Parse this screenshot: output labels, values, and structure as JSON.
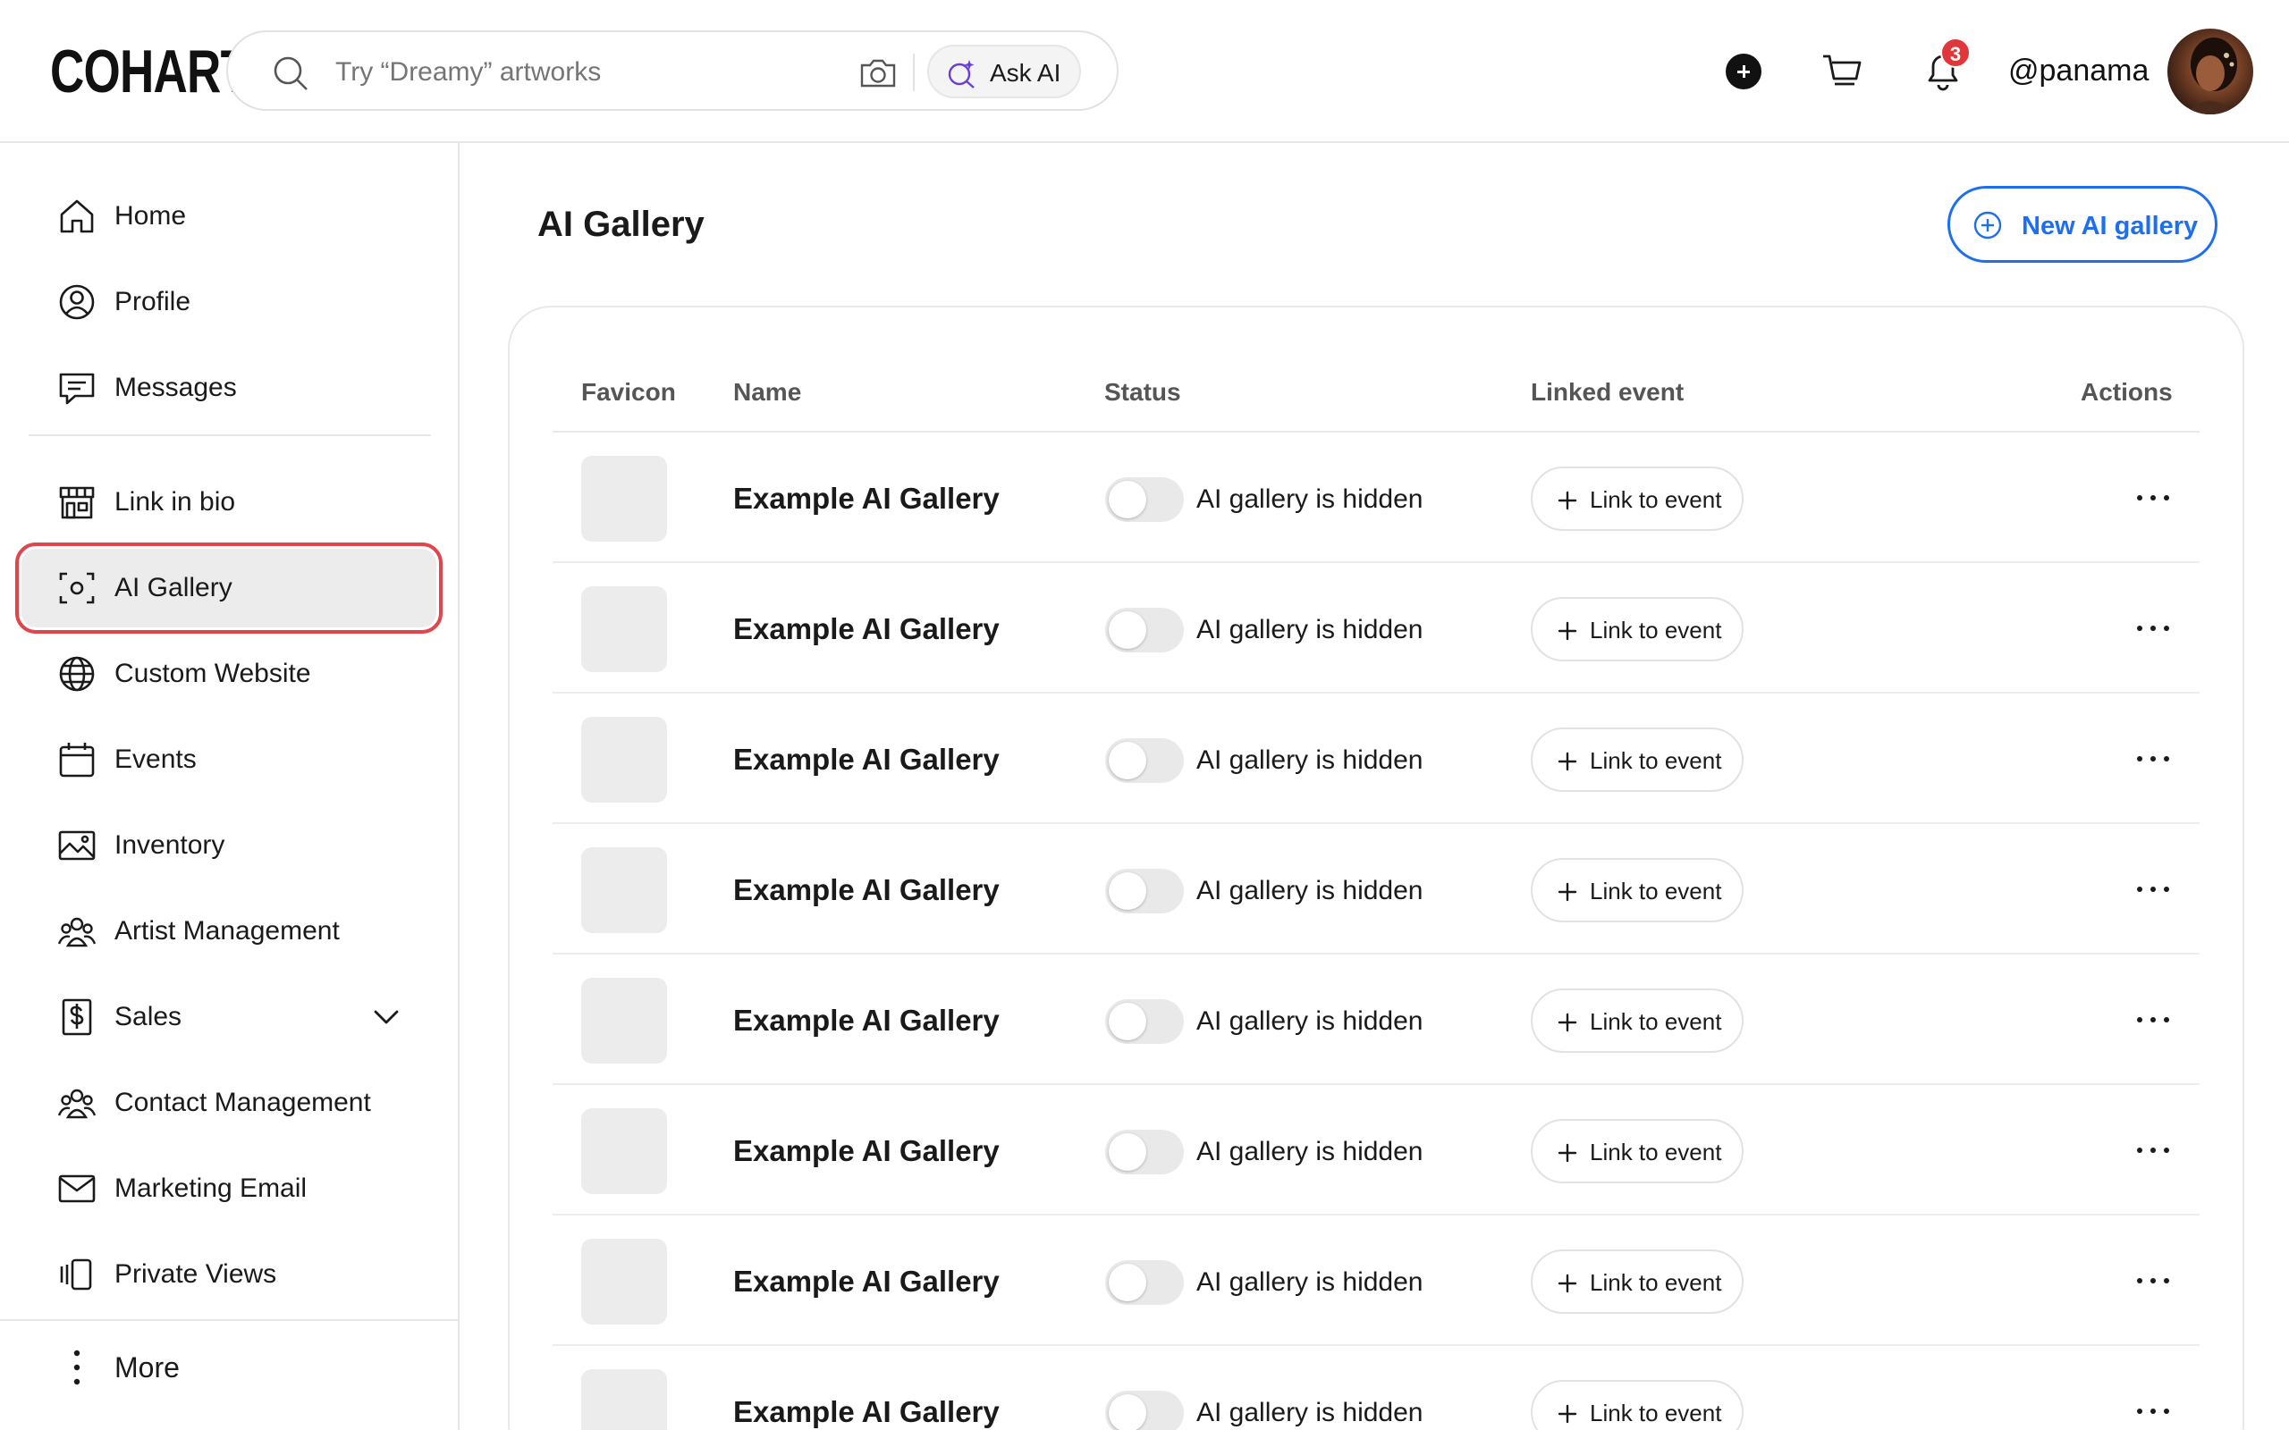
{
  "header": {
    "logo": "COHART",
    "search_placeholder": "Try “Dreamy” artworks",
    "ask_ai_label": "Ask AI",
    "notification_count": "3",
    "username": "@panama"
  },
  "sidebar": {
    "items": [
      {
        "label": "Home",
        "icon": "home-icon"
      },
      {
        "label": "Profile",
        "icon": "profile-icon"
      },
      {
        "label": "Messages",
        "icon": "messages-icon"
      },
      {
        "label": "Link in bio",
        "icon": "storefront-icon"
      },
      {
        "label": "AI Gallery",
        "icon": "scan-icon",
        "active": true
      },
      {
        "label": "Custom Website",
        "icon": "globe-icon"
      },
      {
        "label": "Events",
        "icon": "calendar-icon"
      },
      {
        "label": "Inventory",
        "icon": "image-icon"
      },
      {
        "label": "Artist Management",
        "icon": "users-icon"
      },
      {
        "label": "Sales",
        "icon": "dollar-doc-icon"
      },
      {
        "label": "Contact Management",
        "icon": "users-icon"
      },
      {
        "label": "Marketing Email",
        "icon": "mail-icon"
      },
      {
        "label": "Private Views",
        "icon": "views-icon"
      }
    ],
    "more_label": "More"
  },
  "main": {
    "title": "AI Gallery",
    "new_button_label": "New AI gallery",
    "columns": {
      "favicon": "Favicon",
      "name": "Name",
      "status": "Status",
      "linked_event": "Linked event",
      "actions": "Actions"
    },
    "rows": [
      {
        "name": "Example AI Gallery",
        "status": "AI gallery is hidden",
        "link_label": "Link to event"
      },
      {
        "name": "Example AI Gallery",
        "status": "AI gallery is hidden",
        "link_label": "Link to event"
      },
      {
        "name": "Example AI Gallery",
        "status": "AI gallery is hidden",
        "link_label": "Link to event"
      },
      {
        "name": "Example AI Gallery",
        "status": "AI gallery is hidden",
        "link_label": "Link to event"
      },
      {
        "name": "Example AI Gallery",
        "status": "AI gallery is hidden",
        "link_label": "Link to event"
      },
      {
        "name": "Example AI Gallery",
        "status": "AI gallery is hidden",
        "link_label": "Link to event"
      },
      {
        "name": "Example AI Gallery",
        "status": "AI gallery is hidden",
        "link_label": "Link to event"
      },
      {
        "name": "Example AI Gallery",
        "status": "AI gallery is hidden",
        "link_label": "Link to event"
      }
    ]
  },
  "colors": {
    "accent": "#1e6ff0",
    "active_outline": "#e0454c",
    "badge": "#e0373b"
  }
}
